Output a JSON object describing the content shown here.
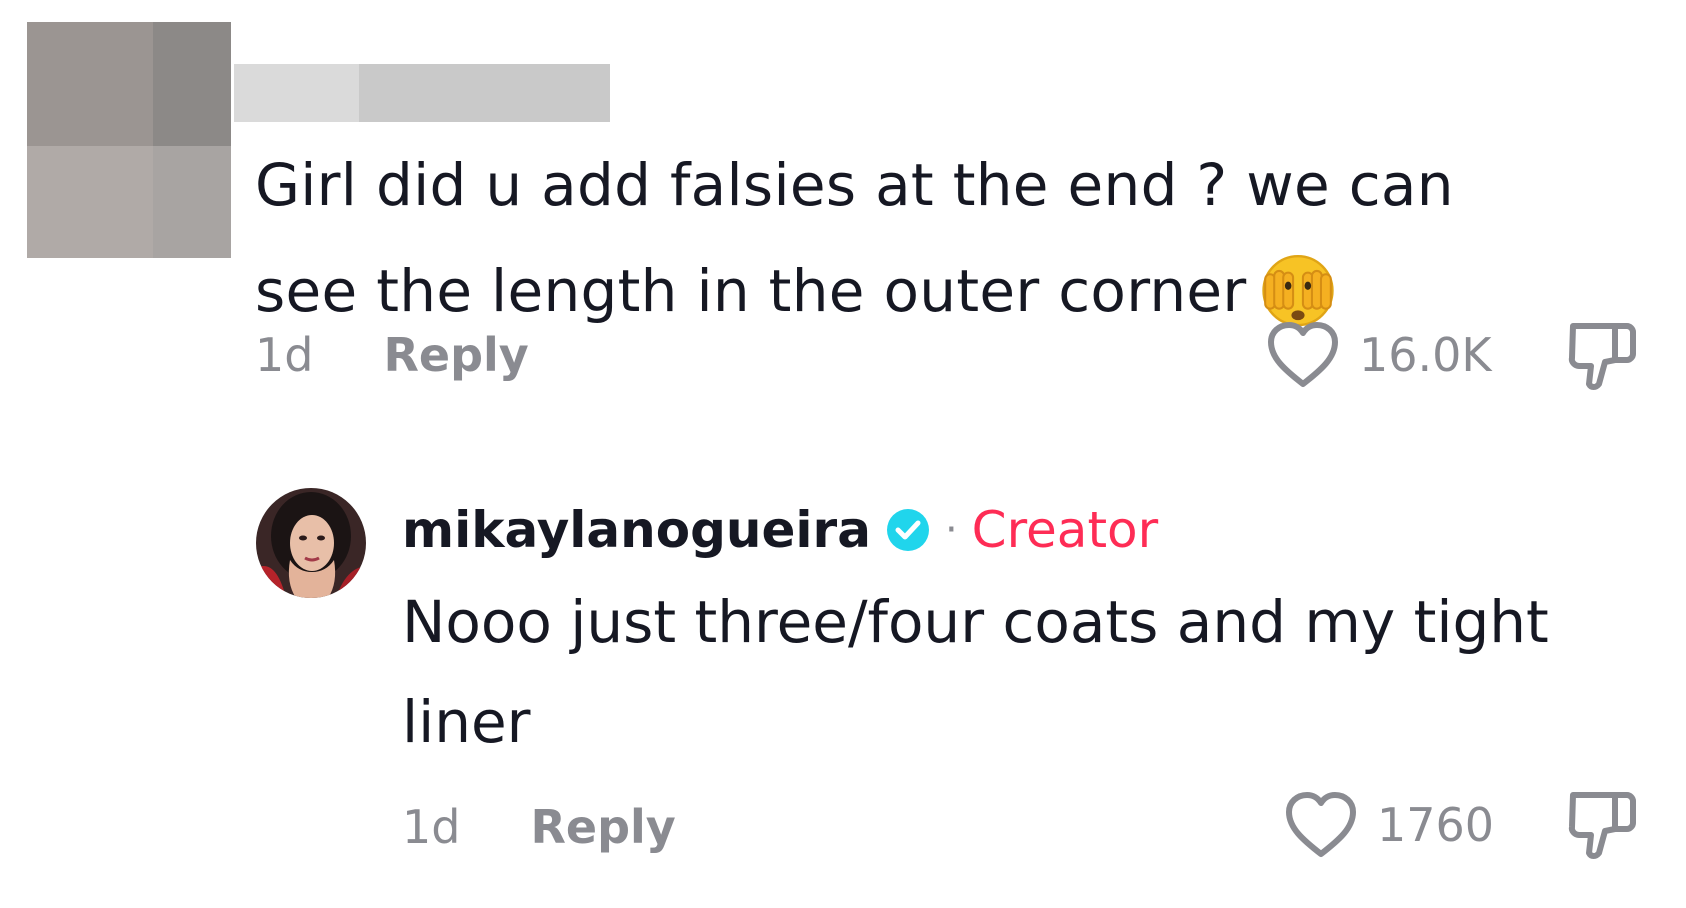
{
  "comment": {
    "text_line1": "Girl did u add falsies at the end ? we can",
    "text_line2": "see the length in the outer corner",
    "emoji": "face-with-peeking-eye-emoji",
    "time": "1d",
    "reply_label": "Reply",
    "likes": "16.0K"
  },
  "reply": {
    "username": "mikaylanogueira",
    "separator": "·",
    "creator_tag": "Creator",
    "text_line1": "Nooo just three/four coats and my tight",
    "text_line2": "liner",
    "time": "1d",
    "reply_label": "Reply",
    "likes": "1760"
  },
  "colors": {
    "text": "#161823",
    "muted": "#8a8b91",
    "creator": "#fe2c55",
    "verified": "#20d5ec"
  }
}
